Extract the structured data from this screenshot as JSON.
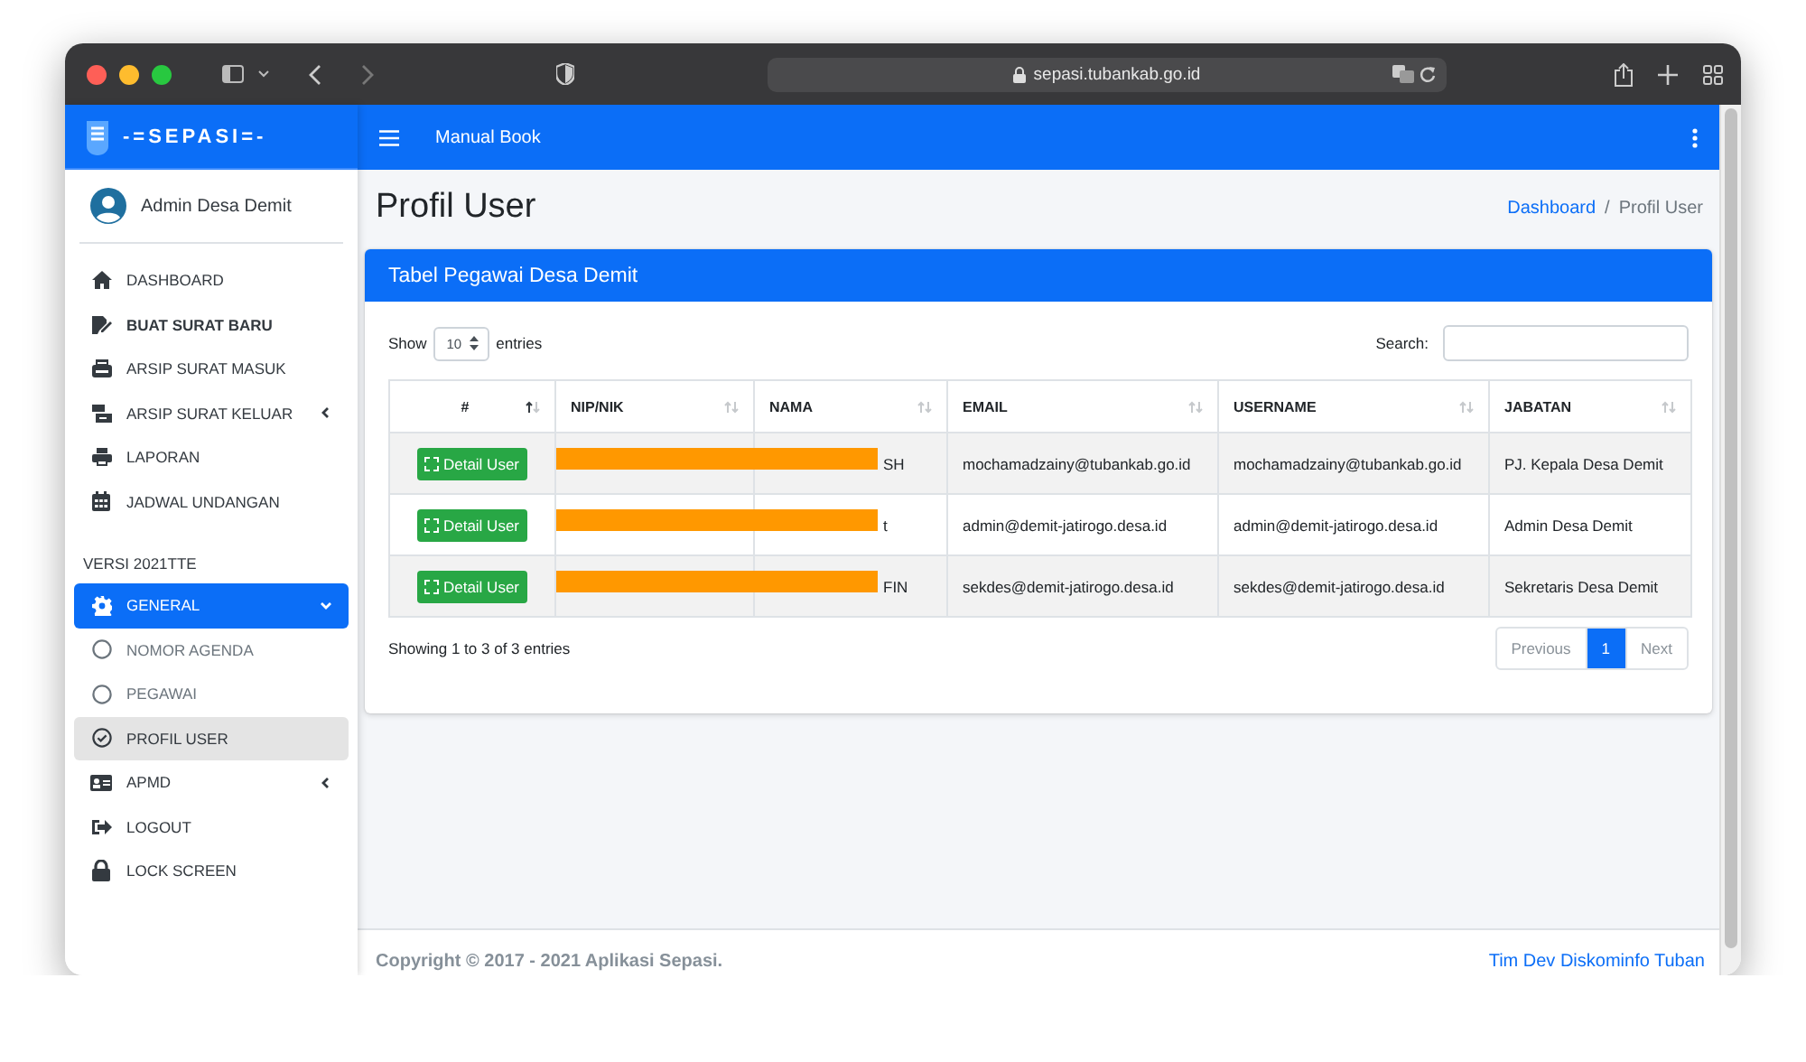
{
  "browser": {
    "url": "sepasi.tubankab.go.id"
  },
  "sidebar": {
    "brand": "-=SEPASI=-",
    "user": "Admin Desa Demit",
    "menu": [
      {
        "kind": "item",
        "label": "DASHBOARD",
        "bold": false,
        "selected": false
      },
      {
        "kind": "item",
        "label": "BUAT SURAT BARU",
        "bold": true,
        "selected": false
      },
      {
        "kind": "item",
        "label": "ARSIP SURAT MASUK",
        "bold": false,
        "selected": false
      },
      {
        "kind": "item",
        "label": "ARSIP SURAT KELUAR",
        "bold": false,
        "selected": false,
        "expanded": false
      },
      {
        "kind": "item",
        "label": "LAPORAN",
        "bold": false,
        "selected": false
      },
      {
        "kind": "item",
        "label": "JADWAL UNDANGAN",
        "bold": false,
        "selected": false
      },
      {
        "kind": "header",
        "label": "VERSI 2021TTE"
      },
      {
        "kind": "item",
        "label": "GENERAL",
        "bold": false,
        "selected": true,
        "expanded": true,
        "children": [
          {
            "label": "NOMOR AGENDA",
            "selected": false
          },
          {
            "label": "PEGAWAI",
            "selected": false
          },
          {
            "label": "PROFIL USER",
            "selected": true
          }
        ]
      },
      {
        "kind": "item",
        "label": "APMD",
        "bold": false,
        "selected": false,
        "expanded": false
      },
      {
        "kind": "item",
        "label": "LOGOUT",
        "bold": false,
        "selected": false
      },
      {
        "kind": "item",
        "label": "LOCK SCREEN",
        "bold": false,
        "selected": false
      }
    ]
  },
  "navbar": {
    "link": "Manual Book"
  },
  "page": {
    "title": "Profil User",
    "breadcrumb_separator": "/",
    "breadcrumb": [
      {
        "label": "Dashboard",
        "link": true
      },
      {
        "label": "Profil User",
        "link": false
      }
    ]
  },
  "card": {
    "title": "Tabel Pegawai Desa Demit",
    "show_label": "Show",
    "page_size": "10",
    "entries_label": "entries",
    "search_label": "Search:",
    "columns": [
      {
        "label": "#",
        "sorted_ascending": true
      },
      {
        "label": "NIP/NIK",
        "sorted_ascending": false
      },
      {
        "label": "NAMA",
        "sorted_ascending": false
      },
      {
        "label": "EMAIL",
        "sorted_ascending": false
      },
      {
        "label": "USERNAME",
        "sorted_ascending": false
      },
      {
        "label": "JABATAN",
        "sorted_ascending": false
      }
    ],
    "rows": [
      {
        "action": "Detail User",
        "redacted": true,
        "nama": "SH",
        "email": "mochamadzainy@tubankab.go.id",
        "username": "mochamadzainy@tubankab.go.id",
        "jabatan": "PJ. Kepala Desa Demit"
      },
      {
        "action": "Detail User",
        "redacted": true,
        "nama": "t",
        "email": "admin@demit-jatirogo.desa.id",
        "username": "admin@demit-jatirogo.desa.id",
        "jabatan": "Admin Desa Demit"
      },
      {
        "action": "Detail User",
        "redacted": true,
        "nama": "FIN",
        "email": "sekdes@demit-jatirogo.desa.id",
        "username": "sekdes@demit-jatirogo.desa.id",
        "jabatan": "Sekretaris Desa Demit"
      }
    ],
    "info": "Showing 1 to 3 of 3 entries",
    "pagination": [
      {
        "label": "Previous",
        "selected": false,
        "disabled": true
      },
      {
        "label": "1",
        "selected": true,
        "disabled": false
      },
      {
        "label": "Next",
        "selected": false,
        "disabled": true
      }
    ]
  },
  "footer": {
    "copyright": "Copyright © 2017 - 2021 Aplikasi Sepasi.",
    "credit": "Tim Dev Diskominfo Tuban"
  }
}
